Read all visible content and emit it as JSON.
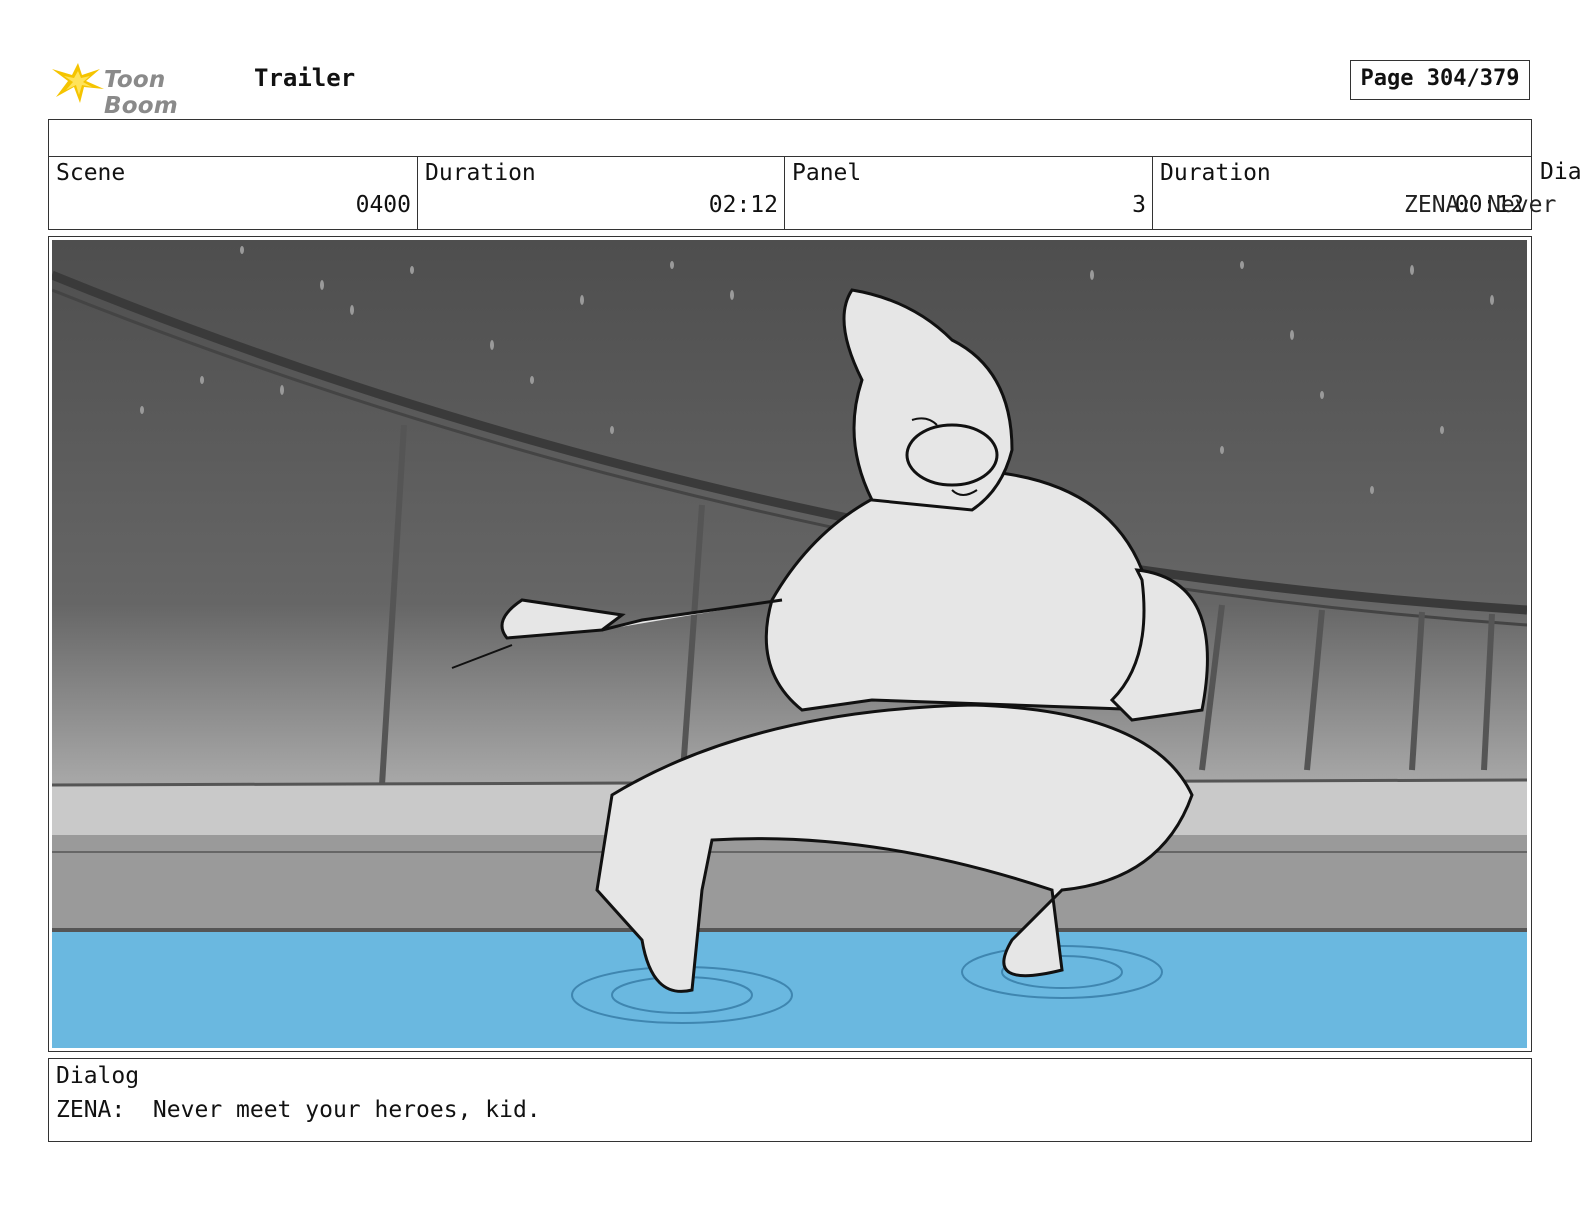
{
  "header": {
    "logo_text": "Toon Boom",
    "project_title": "Trailer",
    "page_number": "Page 304/379"
  },
  "info": {
    "scene_label": "Scene",
    "scene_value": "0400",
    "scene_duration_label": "Duration",
    "scene_duration_value": "02:12",
    "panel_label": "Panel",
    "panel_value": "3",
    "panel_duration_label": "Duration",
    "panel_duration_value": "00:12",
    "overflow_dialog_label": "Dia",
    "overflow_dialog_text": "ZENA:  Never"
  },
  "dialog": {
    "label": "Dialog",
    "text": "ZENA:  Never meet your heroes, kid."
  },
  "colors": {
    "water": "#6ab8e0",
    "logo_accent": "#f5c400"
  }
}
